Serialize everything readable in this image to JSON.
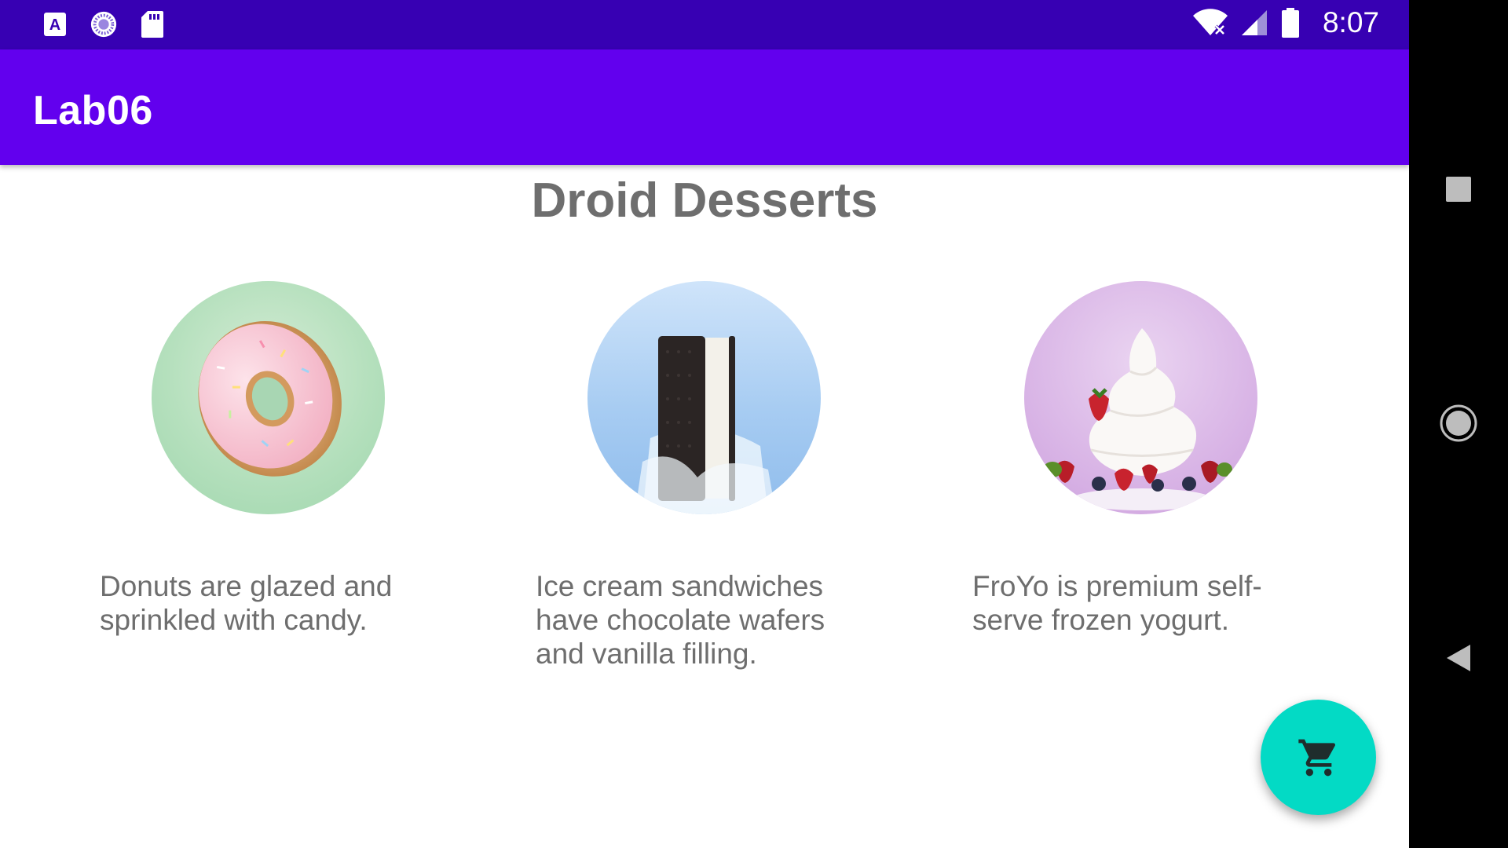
{
  "status_bar": {
    "time": "8:07",
    "left_icons": [
      "accessibility-a-icon",
      "sync-spinner-icon",
      "sd-card-icon"
    ],
    "right_icons": [
      "wifi-no-internet-icon",
      "cell-signal-icon",
      "battery-icon"
    ]
  },
  "app_bar": {
    "title": "Lab06"
  },
  "main": {
    "heading": "Droid Desserts",
    "desserts": [
      {
        "name": "donut",
        "description": "Donuts are glazed and sprinkled with candy."
      },
      {
        "name": "ice-cream-sandwich",
        "description": "Ice cream sandwiches have chocolate wafers and vanilla filling."
      },
      {
        "name": "froyo",
        "description": "FroYo is premium self-serve frozen yogurt."
      }
    ]
  },
  "fab": {
    "icon": "shopping-cart-icon",
    "color": "#03dac5"
  },
  "nav_bar": {
    "buttons": [
      "recents-icon",
      "home-icon",
      "back-icon"
    ]
  },
  "colors": {
    "status_bar": "#3700b3",
    "app_bar": "#6200ee",
    "text_gray": "#6e6e6e"
  }
}
